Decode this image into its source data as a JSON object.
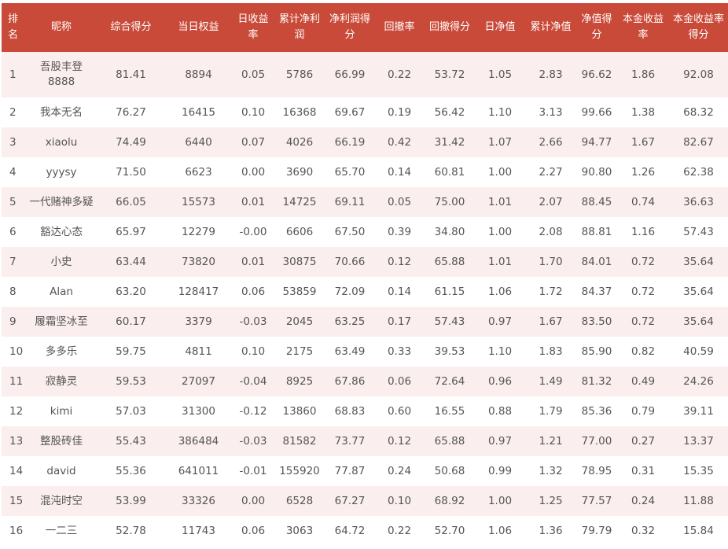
{
  "table": {
    "columns": [
      {
        "key": "rank",
        "label": "排名"
      },
      {
        "key": "nickname",
        "label": "昵称"
      },
      {
        "key": "score",
        "label": "综合得分"
      },
      {
        "key": "equity",
        "label": "当日权益"
      },
      {
        "key": "daily_return",
        "label": "日收益率"
      },
      {
        "key": "cum_profit",
        "label": "累计净利润"
      },
      {
        "key": "profit_score",
        "label": "净利润得分"
      },
      {
        "key": "drawdown",
        "label": "回撤率"
      },
      {
        "key": "drawdown_score",
        "label": "回撤得分"
      },
      {
        "key": "daily_nav",
        "label": "日净值"
      },
      {
        "key": "cum_nav",
        "label": "累计净值"
      },
      {
        "key": "nav_score",
        "label": "净值得分"
      },
      {
        "key": "principal_return",
        "label": "本金收益率"
      },
      {
        "key": "principal_return_score",
        "label": "本金收益率得分"
      }
    ],
    "rows": [
      [
        "1",
        "吾股丰登8888",
        "81.41",
        "8894",
        "0.05",
        "5786",
        "66.99",
        "0.22",
        "53.72",
        "1.05",
        "2.83",
        "96.62",
        "1.86",
        "92.08"
      ],
      [
        "2",
        "我本无名",
        "76.27",
        "16415",
        "0.10",
        "16368",
        "69.67",
        "0.19",
        "56.42",
        "1.10",
        "3.13",
        "99.66",
        "1.38",
        "68.32"
      ],
      [
        "3",
        "xiaolu",
        "74.49",
        "6440",
        "0.07",
        "4026",
        "66.19",
        "0.42",
        "31.42",
        "1.07",
        "2.66",
        "94.77",
        "1.67",
        "82.67"
      ],
      [
        "4",
        "yyysy",
        "71.50",
        "6623",
        "0.00",
        "3690",
        "65.70",
        "0.14",
        "60.81",
        "1.00",
        "2.27",
        "90.80",
        "1.26",
        "62.38"
      ],
      [
        "5",
        "一代赌神多疑",
        "66.05",
        "15573",
        "0.01",
        "14725",
        "69.11",
        "0.05",
        "75.00",
        "1.01",
        "2.07",
        "88.45",
        "0.74",
        "36.63"
      ],
      [
        "6",
        "豁达心态",
        "65.97",
        "12279",
        "-0.00",
        "6606",
        "67.50",
        "0.39",
        "34.80",
        "1.00",
        "2.08",
        "88.81",
        "1.16",
        "57.43"
      ],
      [
        "7",
        "小史",
        "63.44",
        "73820",
        "0.01",
        "30875",
        "70.66",
        "0.12",
        "65.88",
        "1.01",
        "1.70",
        "84.01",
        "0.72",
        "35.64"
      ],
      [
        "8",
        "Alan",
        "63.20",
        "128417",
        "0.06",
        "53859",
        "72.09",
        "0.14",
        "61.15",
        "1.06",
        "1.72",
        "84.37",
        "0.72",
        "35.64"
      ],
      [
        "9",
        "履霜坚冰至",
        "60.17",
        "3379",
        "-0.03",
        "2045",
        "63.25",
        "0.17",
        "57.43",
        "0.97",
        "1.67",
        "83.50",
        "0.72",
        "35.64"
      ],
      [
        "10",
        "多多乐",
        "59.75",
        "4811",
        "0.10",
        "2175",
        "63.49",
        "0.33",
        "39.53",
        "1.10",
        "1.83",
        "85.90",
        "0.82",
        "40.59"
      ],
      [
        "11",
        "寂静灵",
        "59.53",
        "27097",
        "-0.04",
        "8925",
        "67.86",
        "0.06",
        "72.64",
        "0.96",
        "1.49",
        "81.32",
        "0.49",
        "24.26"
      ],
      [
        "12",
        "kimi",
        "57.03",
        "31300",
        "-0.12",
        "13860",
        "68.83",
        "0.60",
        "16.55",
        "0.88",
        "1.79",
        "85.36",
        "0.79",
        "39.11"
      ],
      [
        "13",
        "整股砖佳",
        "55.43",
        "386484",
        "-0.03",
        "81582",
        "73.77",
        "0.12",
        "65.88",
        "0.97",
        "1.21",
        "77.00",
        "0.27",
        "13.37"
      ],
      [
        "14",
        "david",
        "55.36",
        "641011",
        "-0.01",
        "155920",
        "77.87",
        "0.24",
        "50.68",
        "0.99",
        "1.32",
        "78.95",
        "0.31",
        "15.35"
      ],
      [
        "15",
        "混沌时空",
        "53.99",
        "33326",
        "0.00",
        "6528",
        "67.27",
        "0.10",
        "68.92",
        "1.00",
        "1.25",
        "77.57",
        "0.24",
        "11.88"
      ],
      [
        "16",
        "一二三",
        "52.78",
        "11743",
        "0.06",
        "3063",
        "64.72",
        "0.22",
        "52.70",
        "1.06",
        "1.36",
        "79.79",
        "0.32",
        "15.84"
      ]
    ]
  },
  "colors": {
    "header_bg": "#c94a38",
    "header_text": "#ffffff",
    "row_alt_bg": "#fbeeee",
    "row_bg": "#ffffff",
    "body_text": "#555555"
  }
}
